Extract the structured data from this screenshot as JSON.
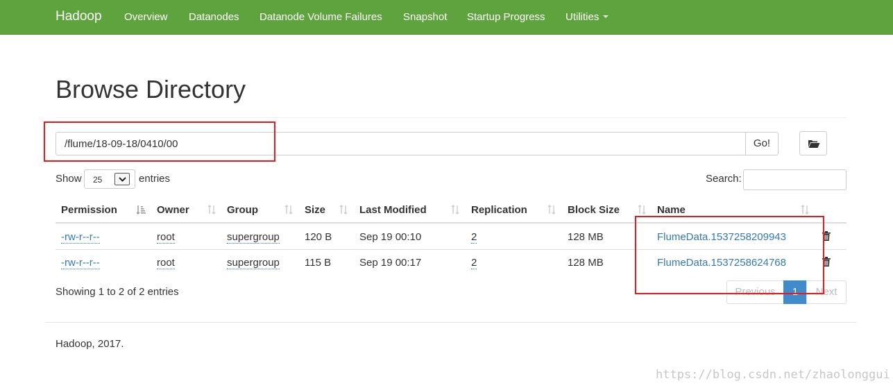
{
  "navbar": {
    "brand": "Hadoop",
    "items": [
      "Overview",
      "Datanodes",
      "Datanode Volume Failures",
      "Snapshot",
      "Startup Progress",
      "Utilities"
    ],
    "color": "#5fa33e"
  },
  "page": {
    "title": "Browse Directory"
  },
  "path_bar": {
    "value": "/flume/18-09-18/0410/00",
    "go_label": "Go!",
    "folder_icon": "folder-open-icon"
  },
  "length_control": {
    "show_label": "Show",
    "selected": "25",
    "entries_label": "entries"
  },
  "search": {
    "label": "Search:",
    "value": ""
  },
  "table": {
    "columns": [
      "Permission",
      "Owner",
      "Group",
      "Size",
      "Last Modified",
      "Replication",
      "Block Size",
      "Name"
    ],
    "rows": [
      {
        "permission": "-rw-r--r--",
        "owner": "root",
        "group": "supergroup",
        "size": "120 B",
        "last_modified": "Sep 19 00:10",
        "replication": "2",
        "block_size": "128 MB",
        "name": "FlumeData.1537258209943"
      },
      {
        "permission": "-rw-r--r--",
        "owner": "root",
        "group": "supergroup",
        "size": "115 B",
        "last_modified": "Sep 19 00:17",
        "replication": "2",
        "block_size": "128 MB",
        "name": "FlumeData.1537258624768"
      }
    ]
  },
  "info": "Showing 1 to 2 of 2 entries",
  "pagination": {
    "previous": "Previous",
    "current": "1",
    "next": "Next",
    "active_color": "#428bca"
  },
  "footer": "Hadoop, 2017.",
  "watermark": "https://blog.csdn.net/zhaolonggui",
  "annotation_color": "#e8191e"
}
